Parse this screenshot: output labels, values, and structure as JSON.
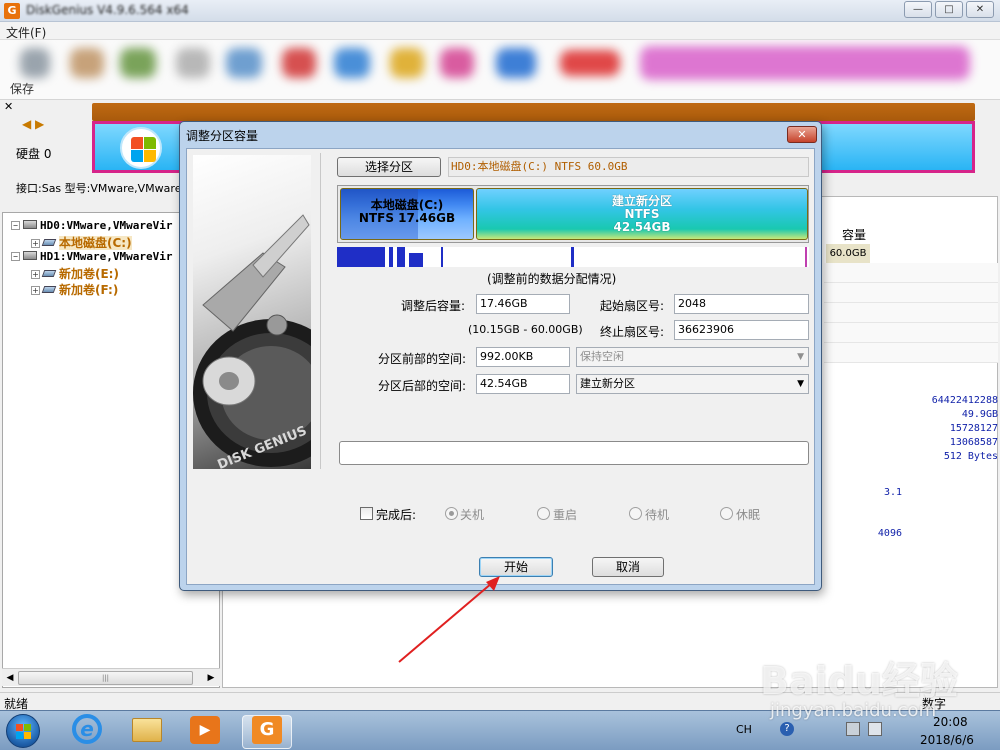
{
  "app": {
    "title": "DiskGenius V4.9.6.564 x64",
    "logo": "G"
  },
  "menu": {
    "file": "文件(F)"
  },
  "toolbar": {
    "save_label": "保存"
  },
  "disk_panel": {
    "disk_label": "硬盘 0",
    "interface": "接口:Sas   型号:VMware,VMware"
  },
  "tree": {
    "items": [
      {
        "label": "HD0:VMware,VMwareVir",
        "kind": "disk"
      },
      {
        "label": "本地磁盘(C:)",
        "kind": "partition"
      },
      {
        "label": "HD1:VMware,VMwareVir",
        "kind": "disk"
      },
      {
        "label": "新加卷(E:)",
        "kind": "partition"
      },
      {
        "label": "新加卷(F:)",
        "kind": "partition"
      }
    ]
  },
  "right_panel": {
    "col_capacity": "容量",
    "capacity_value": "60.0GB",
    "info_values": [
      "64422412288",
      "49.9GB",
      "15728127",
      "13068587",
      "512 Bytes",
      "3.1",
      "4096"
    ]
  },
  "status": {
    "ready": "就绪",
    "numlock": "数字"
  },
  "dialog": {
    "title": "调整分区容量",
    "select_partition_btn": "选择分区",
    "partition_desc": "HD0:本地磁盘(C:) NTFS 60.0GB",
    "segments": {
      "c": {
        "line1": "本地磁盘(C:)",
        "line2": "NTFS 17.46GB",
        "used_fraction": 0.58
      },
      "new": {
        "line1": "建立新分区",
        "line2": "NTFS",
        "line3": "42.54GB"
      }
    },
    "map_caption": "(调整前的数据分配情况)",
    "fields": {
      "size_after_label": "调整后容量:",
      "size_after_value": "17.46GB",
      "size_range": "(10.15GB - 60.00GB)",
      "start_sector_label": "起始扇区号:",
      "start_sector_value": "2048",
      "end_sector_label": "终止扇区号:",
      "end_sector_value": "36623906",
      "space_before_label": "分区前部的空间:",
      "space_before_value": "992.00KB",
      "space_before_option": "保持空闲",
      "space_after_label": "分区后部的空间:",
      "space_after_value": "42.54GB",
      "space_after_option": "建立新分区"
    },
    "after_done": {
      "label": "完成后:",
      "options": [
        "关机",
        "重启",
        "待机",
        "休眠"
      ]
    },
    "start_btn": "开始",
    "cancel_btn": "取消",
    "disk_genius_text": "DISK GENIUS"
  },
  "taskbar": {
    "ime": "CH",
    "time": "20:08",
    "date": "2018/6/6"
  },
  "watermark": {
    "brand": "Baidu经验",
    "url": "jingyan.baidu.com"
  }
}
